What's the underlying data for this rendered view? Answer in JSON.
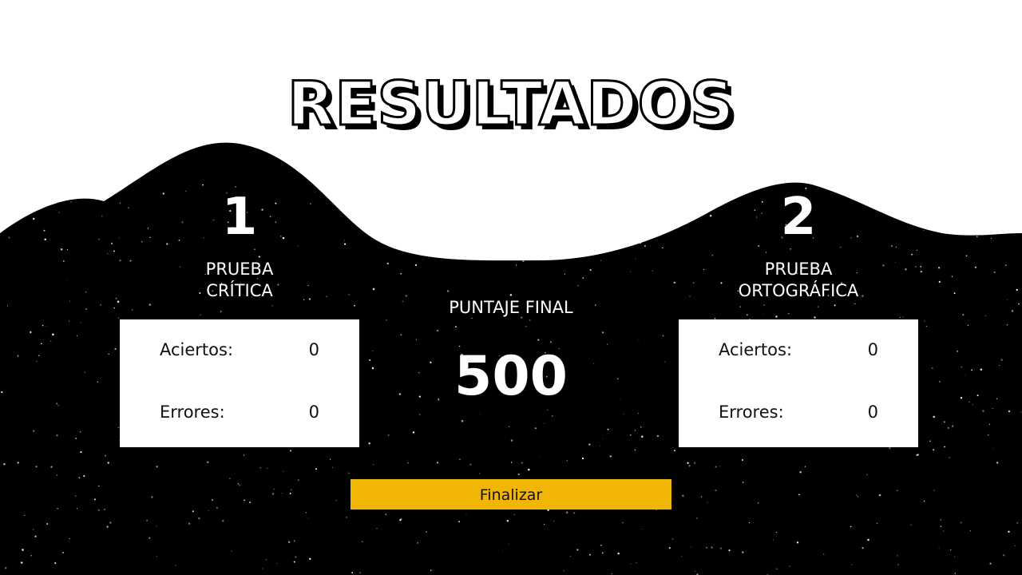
{
  "title": "RESULTADOS",
  "test1": {
    "number": "1",
    "label_line1": "PRUEBA",
    "label_line2": "CRÍTICA",
    "hits_label": "Aciertos:",
    "hits_value": "0",
    "errors_label": "Errores:",
    "errors_value": "0"
  },
  "test2": {
    "number": "2",
    "label_line1": "PRUEBA",
    "label_line2": "ORTOGRÁFICA",
    "hits_label": "Aciertos:",
    "hits_value": "0",
    "errors_label": "Errores:",
    "errors_value": "0"
  },
  "final": {
    "label": "PUNTAJE FINAL",
    "score": "500"
  },
  "button": {
    "label": "Finalizar"
  },
  "colors": {
    "button": "#f0b505",
    "background": "#000000"
  }
}
